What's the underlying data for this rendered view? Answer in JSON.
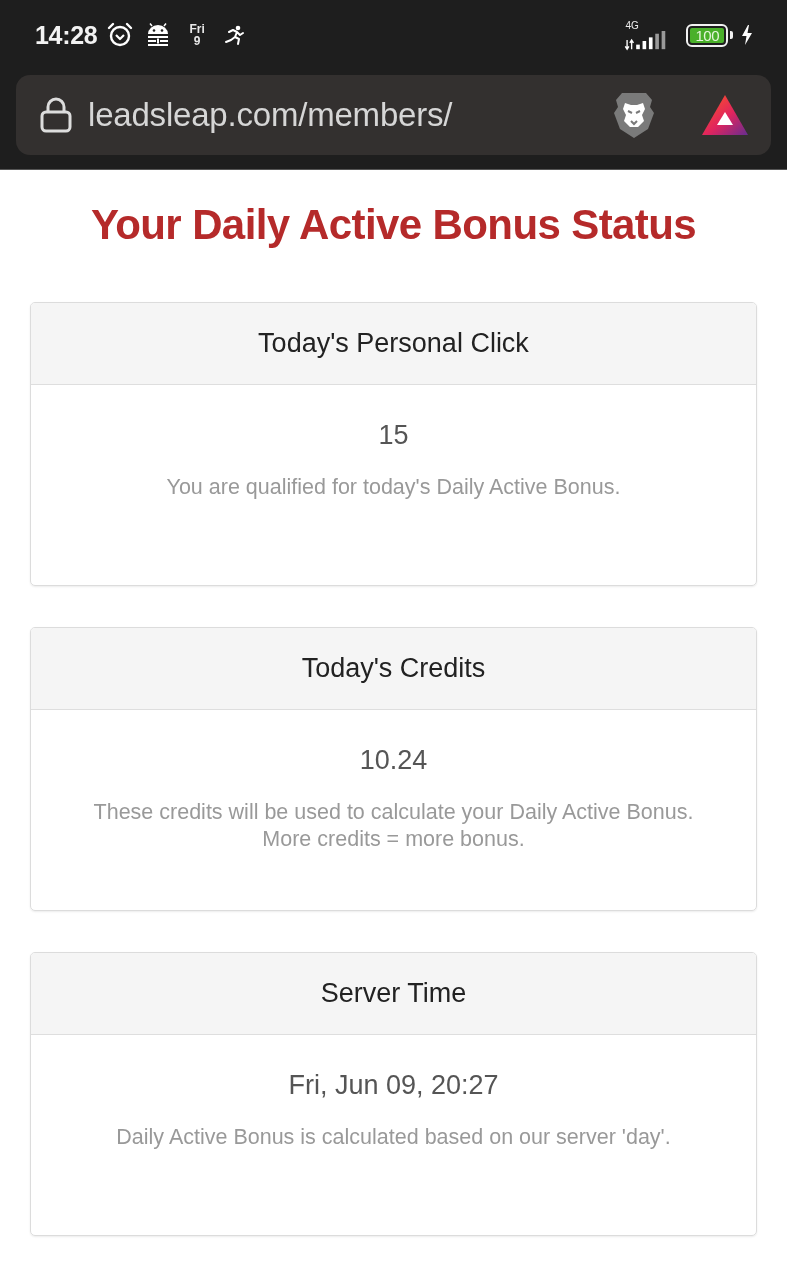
{
  "status_bar": {
    "time": "14:28",
    "day": "Fri",
    "date": "9",
    "network": "4G",
    "battery": "100"
  },
  "address_bar": {
    "url": "leadsleap.com/members/"
  },
  "title": "Your Daily Active Bonus Status",
  "cards": [
    {
      "title": "Today's Personal Click",
      "value": "15",
      "description": "You are qualified for today's Daily Active Bonus."
    },
    {
      "title": "Today's Credits",
      "value": "10.24",
      "description": "These credits will be used to calculate your Daily Active Bonus.\nMore credits = more bonus."
    },
    {
      "title": "Server Time",
      "value": "Fri, Jun 09, 20:27",
      "description": "Daily Active Bonus is calculated based on our server 'day'."
    }
  ]
}
